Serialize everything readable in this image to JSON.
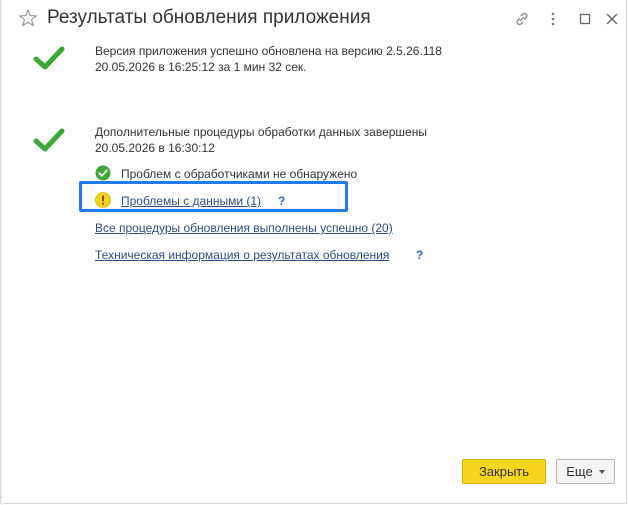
{
  "window": {
    "title": "Результаты обновления приложения"
  },
  "section_update": {
    "line1": "Версия приложения успешно обновлена на версию 2.5.26.118",
    "line2": "20.05.2026 в 16:25:12 за 1 мин 32 сек."
  },
  "section_procedures": {
    "line1": "Дополнительные процедуры обработки данных завершены",
    "line2": "20.05.2026 в 16:30:12",
    "handlers_status": "Проблем с обработчиками не обнаружено",
    "data_problems_link": "Проблемы с данными (1)",
    "all_procedures_link": "Все процедуры обновления выполнены успешно (20)",
    "tech_info_link": "Техническая информация о результатах обновления",
    "help_mark": "?"
  },
  "footer": {
    "close_label": "Закрыть",
    "more_label": "Еще"
  },
  "colors": {
    "check_green": "#3aa935",
    "warning_yellow": "#f5d31a",
    "highlight_blue": "#1f7bef",
    "primary_button": "#f7d51d",
    "link": "#2a4d8f"
  },
  "icons": {
    "favorite": "star-icon",
    "link": "link-icon",
    "menu": "more-vertical-icon",
    "maximize": "maximize-icon",
    "close": "close-icon",
    "success": "checkmark-icon",
    "warning": "warning-icon"
  }
}
